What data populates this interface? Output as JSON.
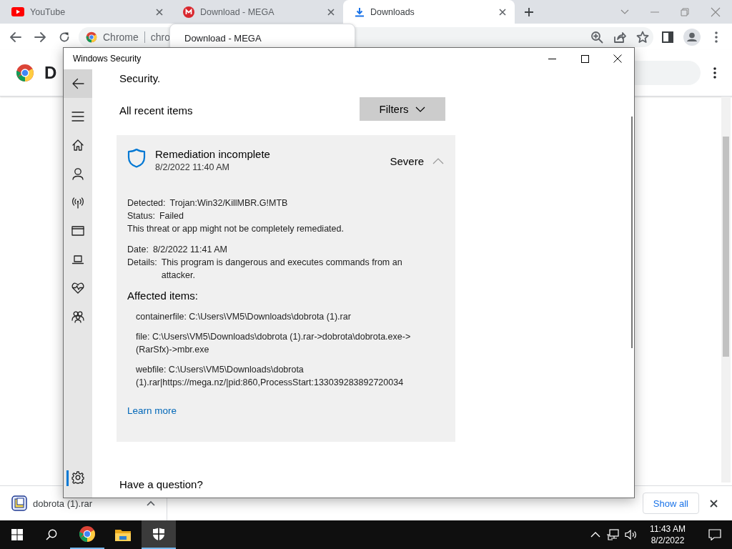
{
  "browser": {
    "tabs": [
      {
        "title": "YouTube",
        "kind": "youtube",
        "selected": false
      },
      {
        "title": "Download - MEGA",
        "kind": "mega",
        "selected": false
      },
      {
        "title": "Downloads",
        "kind": "download",
        "selected": true
      }
    ],
    "address_bar": {
      "site_label": "Chrome",
      "url": "chro"
    },
    "tab_tooltip": "Download - MEGA",
    "page_title": "D",
    "download_shelf": {
      "items": [
        {
          "filename": "dobrota (1).rar"
        }
      ],
      "show_all": "Show all"
    }
  },
  "security_window": {
    "title": "Windows Security",
    "nav": [
      {
        "kind": "back",
        "selected": false
      },
      {
        "kind": "menu",
        "selected": false
      },
      {
        "kind": "home",
        "selected": false
      },
      {
        "kind": "account",
        "selected": false
      },
      {
        "kind": "network",
        "selected": false
      },
      {
        "kind": "browser",
        "selected": false
      },
      {
        "kind": "device",
        "selected": false
      },
      {
        "kind": "health",
        "selected": false
      },
      {
        "kind": "family",
        "selected": false
      },
      {
        "kind": "settings",
        "selected": true
      }
    ],
    "heading": "Security.",
    "list_title": "All recent items",
    "filters_button": "Filters",
    "card": {
      "title": "Remediation incomplete",
      "timestamp": "8/2/2022 11:40 AM",
      "severity": "Severe",
      "expanded": true,
      "fields": [
        {
          "label": "Detected:",
          "value": "Trojan:Win32/KillMBR.G!MTB"
        },
        {
          "label": "Status:",
          "value": "Failed"
        }
      ],
      "note": "This threat or app might not be completely remediated.",
      "fields_2": [
        {
          "label": "Date:",
          "value": "8/2/2022 11:41 AM"
        },
        {
          "label": "Details:",
          "value": "This program is dangerous and executes commands from an attacker."
        }
      ],
      "affected_title": "Affected items:",
      "affected_items": [
        "containerfile: C:\\Users\\VM5\\Downloads\\dobrota (1).rar",
        "file: C:\\Users\\VM5\\Downloads\\dobrota (1).rar->dobrota\\dobrota.exe->(RarSfx)->mbr.exe",
        "webfile: C:\\Users\\VM5\\Downloads\\dobrota (1).rar|https://mega.nz/|pid:860,ProcessStart:133039283892720034"
      ],
      "learn_more": "Learn more"
    },
    "question": "Have a question?"
  },
  "taskbar": {
    "apps": [
      {
        "kind": "chrome",
        "running": true,
        "selected": false
      },
      {
        "kind": "explorer",
        "running": false,
        "selected": false
      },
      {
        "kind": "security",
        "running": true,
        "selected": true
      }
    ],
    "time": "11:43 AM",
    "date": "8/2/2022"
  }
}
